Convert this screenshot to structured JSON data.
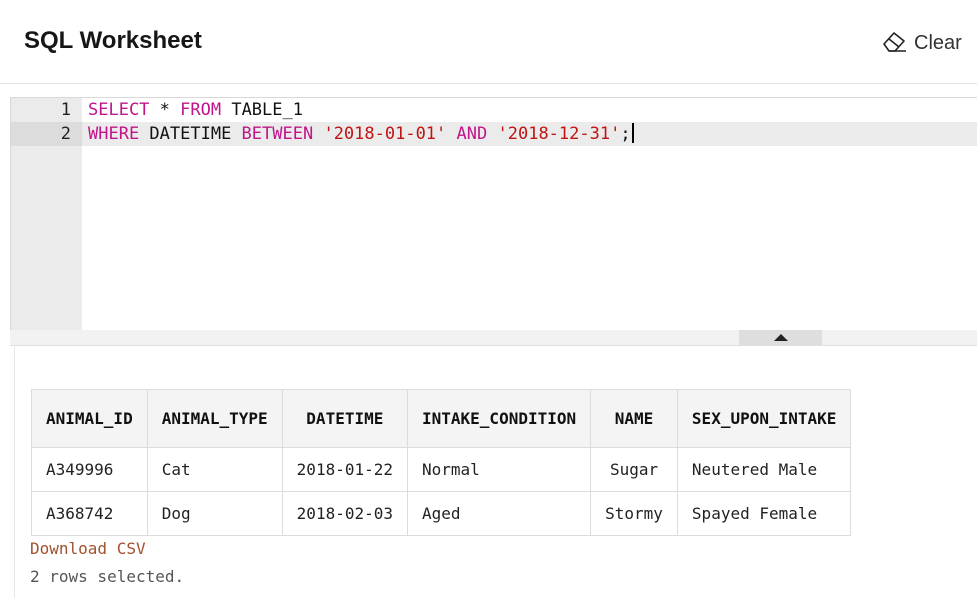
{
  "header": {
    "title": "SQL Worksheet",
    "clear_label": "Clear"
  },
  "editor": {
    "line_numbers": [
      "1",
      "2"
    ],
    "lines": [
      [
        {
          "t": "SELECT",
          "k": "kw"
        },
        {
          "t": " * ",
          "k": ""
        },
        {
          "t": "FROM",
          "k": "kw"
        },
        {
          "t": " TABLE_1",
          "k": ""
        }
      ],
      [
        {
          "t": "WHERE",
          "k": "kw"
        },
        {
          "t": " DATETIME ",
          "k": ""
        },
        {
          "t": "BETWEEN",
          "k": "kw"
        },
        {
          "t": " ",
          "k": ""
        },
        {
          "t": "'2018-01-01'",
          "k": "str"
        },
        {
          "t": " ",
          "k": ""
        },
        {
          "t": "AND",
          "k": "kw"
        },
        {
          "t": " ",
          "k": ""
        },
        {
          "t": "'2018-12-31'",
          "k": "str"
        },
        {
          "t": ";",
          "k": ""
        }
      ]
    ]
  },
  "results": {
    "columns": [
      "ANIMAL_ID",
      "ANIMAL_TYPE",
      "DATETIME",
      "INTAKE_CONDITION",
      "NAME",
      "SEX_UPON_INTAKE"
    ],
    "rows": [
      [
        "A349996",
        "Cat",
        "2018-01-22",
        "Normal",
        "Sugar",
        "Neutered Male"
      ],
      [
        "A368742",
        "Dog",
        "2018-02-03",
        "Aged",
        "Stormy",
        "Spayed Female"
      ]
    ],
    "download_label": "Download CSV",
    "status": "2 rows selected."
  },
  "colors": {
    "keyword": "#c0158a",
    "string": "#c01313",
    "link": "#a0522d"
  },
  "icons": {
    "clear": "eraser-icon",
    "splitter": "triangle-up-icon"
  }
}
